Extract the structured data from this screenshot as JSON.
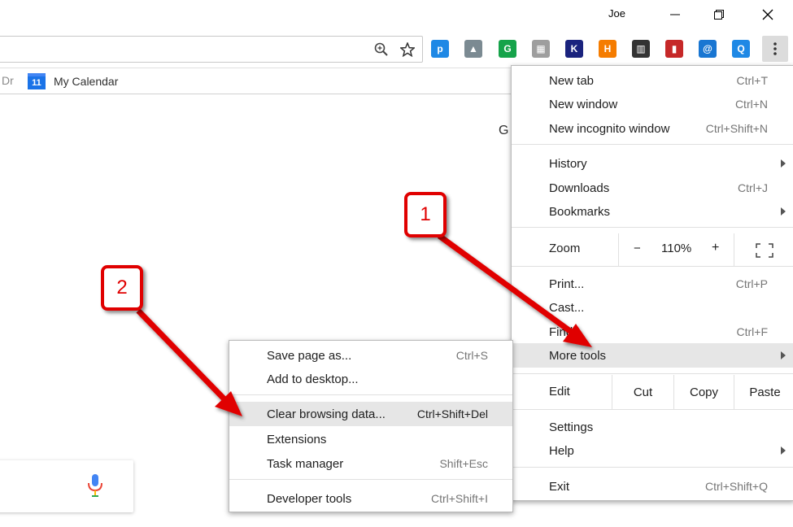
{
  "titlebar": {
    "user": "Joe",
    "minimize_icon": "minimize-icon",
    "restore_icon": "restore-icon",
    "close_icon": "close-icon"
  },
  "toolbar": {
    "zoom_icon": "zoom-magnifier-icon",
    "star_icon": "bookmark-star-icon",
    "extensions": [
      {
        "name": "pushbullet-icon",
        "color": "#1e88e5",
        "glyph": "p"
      },
      {
        "name": "pdf-extension-icon",
        "color": "#7b8a92",
        "glyph": "▲"
      },
      {
        "name": "grammarly-icon",
        "color": "#16a34a",
        "glyph": "G"
      },
      {
        "name": "calculator-icon",
        "color": "#9e9e9e",
        "glyph": "▦"
      },
      {
        "name": "klout-icon",
        "color": "#1a237e",
        "glyph": "K"
      },
      {
        "name": "honey-icon",
        "color": "#f57c00",
        "glyph": "H"
      },
      {
        "name": "film-strip-icon",
        "color": "#333333",
        "glyph": "▥"
      },
      {
        "name": "red-book-icon",
        "color": "#c62828",
        "glyph": "▮"
      },
      {
        "name": "satellite-at-icon",
        "color": "#1976d2",
        "glyph": "@"
      },
      {
        "name": "blue-q-icon",
        "color": "#1e88e5",
        "glyph": "Q"
      }
    ],
    "menu_icon": "more-vert-icon"
  },
  "bookmarks": {
    "fragment": "Dr",
    "items": [
      {
        "label": "My Calendar",
        "icon_text": "11"
      }
    ]
  },
  "page": {
    "partial_text": "G"
  },
  "search": {
    "mic_icon": "microphone-icon"
  },
  "main_menu": {
    "items": {
      "new_tab": {
        "label": "New tab",
        "shortcut": "Ctrl+T"
      },
      "new_window": {
        "label": "New window",
        "shortcut": "Ctrl+N"
      },
      "new_incognito": {
        "label": "New incognito window",
        "shortcut": "Ctrl+Shift+N"
      },
      "history": {
        "label": "History"
      },
      "downloads": {
        "label": "Downloads",
        "shortcut": "Ctrl+J"
      },
      "bookmarks": {
        "label": "Bookmarks"
      },
      "print": {
        "label": "Print...",
        "shortcut": "Ctrl+P"
      },
      "cast": {
        "label": "Cast..."
      },
      "find": {
        "label": "Find...",
        "shortcut": "Ctrl+F"
      },
      "more_tools": {
        "label": "More tools"
      },
      "settings": {
        "label": "Settings"
      },
      "help": {
        "label": "Help"
      },
      "exit": {
        "label": "Exit",
        "shortcut": "Ctrl+Shift+Q"
      }
    },
    "zoom": {
      "label": "Zoom",
      "minus": "−",
      "value": "110%",
      "plus": "+"
    },
    "edit": {
      "label": "Edit",
      "cut": "Cut",
      "copy": "Copy",
      "paste": "Paste"
    }
  },
  "sub_menu": {
    "items": {
      "save_page": {
        "label": "Save page as...",
        "shortcut": "Ctrl+S"
      },
      "add_desktop": {
        "label": "Add to desktop..."
      },
      "clear_data": {
        "label": "Clear browsing data...",
        "shortcut": "Ctrl+Shift+Del"
      },
      "extensions": {
        "label": "Extensions"
      },
      "task_manager": {
        "label": "Task manager",
        "shortcut": "Shift+Esc"
      },
      "dev_tools": {
        "label": "Developer tools",
        "shortcut": "Ctrl+Shift+I"
      }
    }
  },
  "annotations": {
    "step1": "1",
    "step2": "2",
    "color": "#e00000"
  }
}
